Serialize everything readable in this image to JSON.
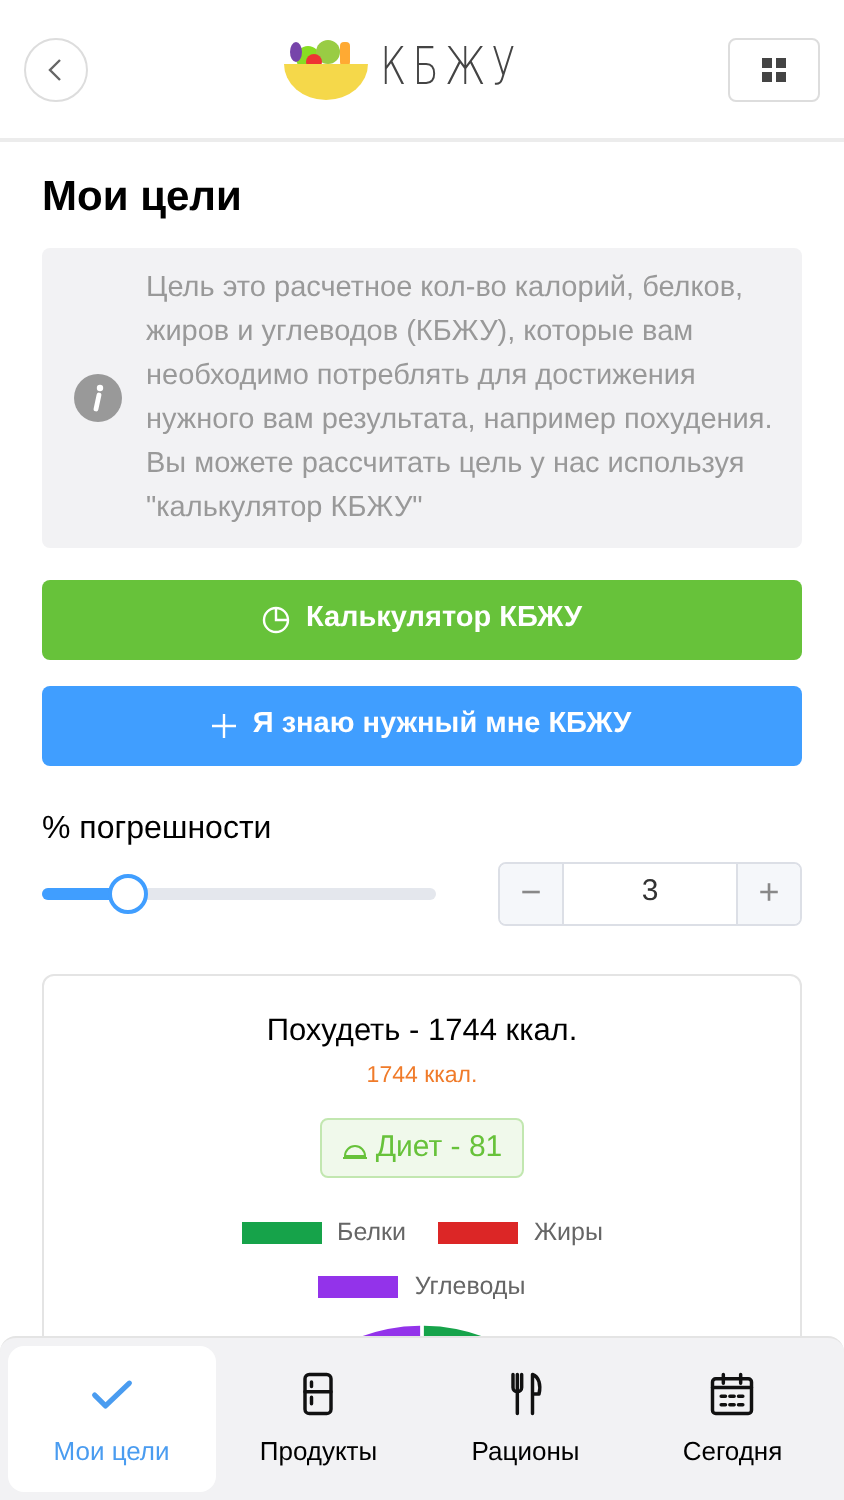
{
  "header": {
    "logo_text": "КБЖУ"
  },
  "title": "Мои цели",
  "info": "Цель это расчетное кол-во калорий, белков, жиров и углеводов (КБЖУ), которые вам необходимо потреблять для достижения нужного вам результата, например похудения. Вы можете рассчитать цель у нас используя \"калькулятор КБЖУ\"",
  "buttons": [
    {
      "kind": "calculator",
      "label": "Калькулятор КБЖУ"
    },
    {
      "kind": "add",
      "label": "Я знаю нужный мне КБЖУ"
    }
  ],
  "tolerance": {
    "label": "% погрешности",
    "level": 0.22,
    "value": "3",
    "minus": "−",
    "plus": "+"
  },
  "goal_card": {
    "title": "Похудеть - 1744 ккал.",
    "subtitle": "1744 ккал.",
    "diet": "Диет - 81",
    "legend": [
      {
        "label": "Белки",
        "color": "#16a34a"
      },
      {
        "label": "Жиры",
        "color": "#dc2626"
      },
      {
        "label": "Углеводы",
        "color": "#9333ea"
      }
    ]
  },
  "nav": [
    {
      "kind": "check",
      "label": "Мои цели",
      "selected": true
    },
    {
      "kind": "fridge",
      "label": "Продукты",
      "selected": false
    },
    {
      "kind": "cutlery",
      "label": "Рационы",
      "selected": false
    },
    {
      "kind": "calendar",
      "label": "Сегодня",
      "selected": false
    }
  ]
}
